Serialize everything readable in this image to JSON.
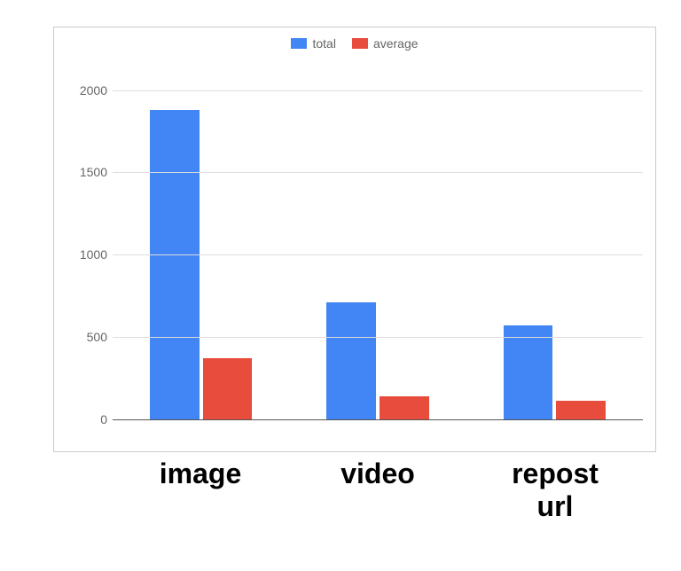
{
  "chart_data": {
    "type": "bar",
    "categories": [
      "image",
      "video",
      "repost\nurl"
    ],
    "series": [
      {
        "name": "total",
        "color": "#4285f4",
        "values": [
          1880,
          710,
          570
        ]
      },
      {
        "name": "average",
        "color": "#e74c3c",
        "values": [
          370,
          140,
          115
        ]
      }
    ],
    "ylim": [
      0,
      2100
    ],
    "yticks": [
      0,
      500,
      1000,
      1500,
      2000
    ],
    "title": "",
    "xlabel": "",
    "ylabel": ""
  },
  "legend": {
    "items": [
      {
        "label": "total"
      },
      {
        "label": "average"
      }
    ]
  }
}
